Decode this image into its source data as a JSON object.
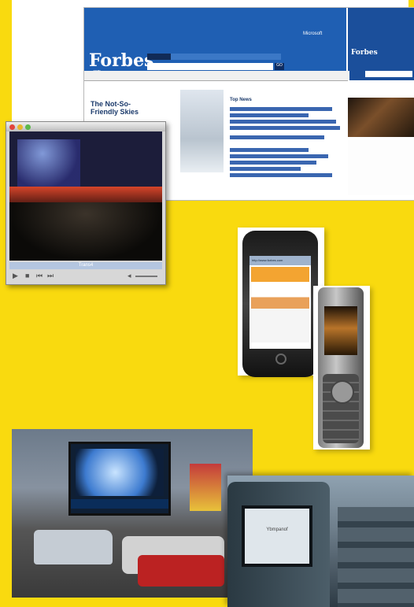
{
  "web": {
    "logo": "Forbes",
    "logo_sub": ".com",
    "banner_mini": "Microsoft",
    "search_placeholder": "",
    "search_go": "GO",
    "right_logo": "Forbes",
    "right_cta": "",
    "article_title": "The Not-So-Friendly Skies",
    "top_stories_title": "Top News"
  },
  "player": {
    "label": "Trans4"
  },
  "iphone": {
    "url": "http://www.forbes.com"
  },
  "outdoor": {
    "ticker": ""
  },
  "cabin": {
    "screen_text": "Ybmpanof"
  },
  "colors": {
    "background": "#f9da0f",
    "forbes_blue": "#1f5fb3"
  }
}
